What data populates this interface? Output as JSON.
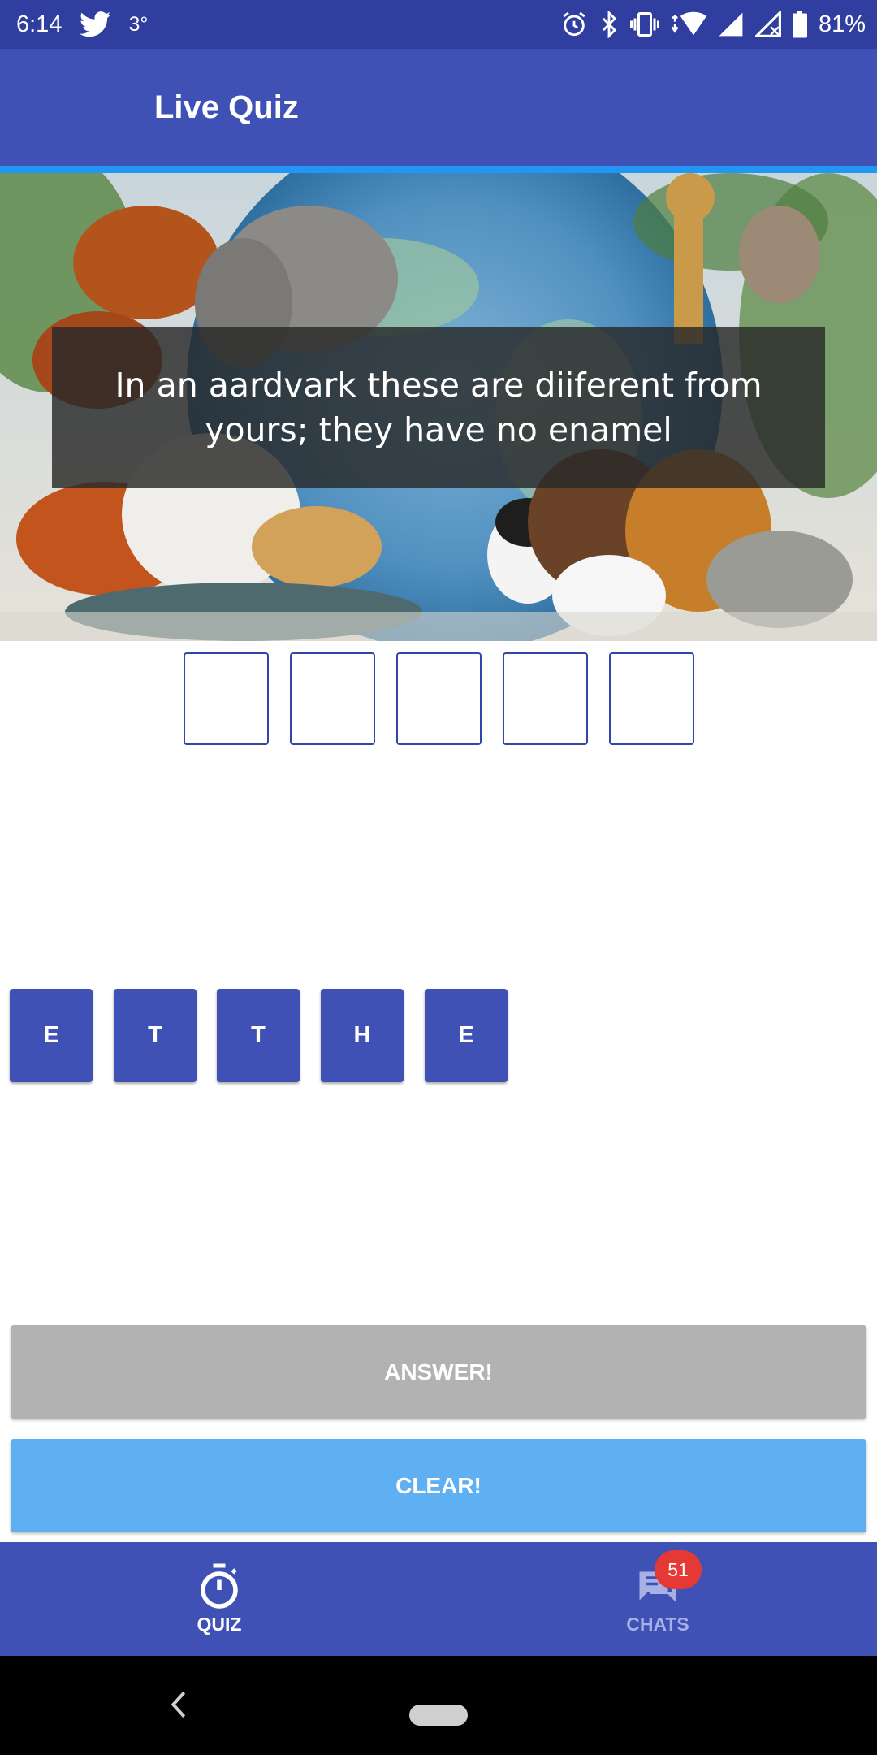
{
  "status_bar": {
    "time": "6:14",
    "temperature": "3°",
    "battery": "81%",
    "icons": [
      "twitter-icon",
      "alarm-icon",
      "bluetooth-icon",
      "vibrate-icon",
      "wifi-icon",
      "signal-icon",
      "signal-off-icon",
      "battery-icon"
    ]
  },
  "app_bar": {
    "title": "Live Quiz"
  },
  "question": {
    "text": "In an aardvark these are diiferent from yours; they have no enamel"
  },
  "answer_slots": [
    "",
    "",
    "",
    "",
    ""
  ],
  "letter_tiles": [
    "E",
    "T",
    "T",
    "H",
    "E"
  ],
  "buttons": {
    "answer": "ANSWER!",
    "clear": "CLEAR!"
  },
  "bottom_nav": {
    "quiz_label": "QUIZ",
    "chats_label": "CHATS",
    "chats_badge": "51"
  },
  "colors": {
    "primary": "#3f51b5",
    "primary_dark": "#303f9f",
    "accent": "#2196f3",
    "answer_button": "#b2b2b2",
    "clear_button": "#5eb0f2",
    "badge": "#e53935"
  }
}
